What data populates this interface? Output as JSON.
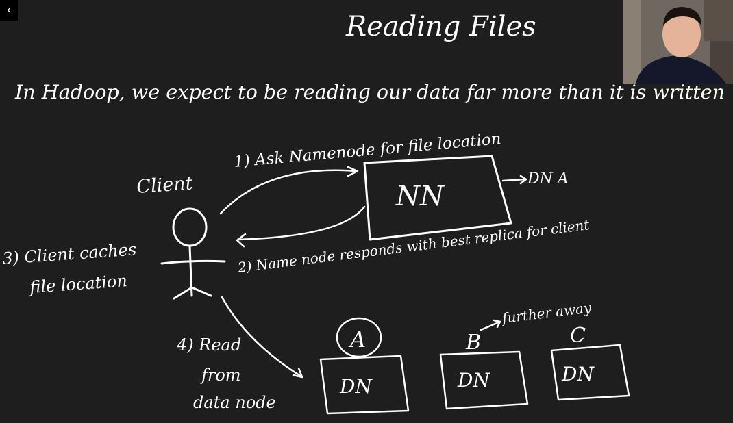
{
  "nav": {
    "back_icon": "‹"
  },
  "webcam": {
    "icon": "presenter-webcam"
  },
  "whiteboard": {
    "title": "Reading Files",
    "subtitle": "In Hadoop, we expect to be reading our data far more than it is written",
    "client_label": "Client",
    "namenode_label": "NN",
    "namenode_side_label": "DN A",
    "step1": "1) Ask Namenode for file location",
    "step2": "2) Name node responds with best replica for client",
    "step3_line1": "3) Client caches",
    "step3_line2": "file location",
    "step4_line1": "4) Read",
    "step4_line2": "from",
    "step4_line3": "data node",
    "datanodes": [
      {
        "replica": "A",
        "label": "DN"
      },
      {
        "replica": "B",
        "label": "DN",
        "note": "further away"
      },
      {
        "replica": "C",
        "label": "DN"
      }
    ]
  },
  "colors": {
    "background": "#1e1e1e",
    "ink": "#ffffff"
  }
}
